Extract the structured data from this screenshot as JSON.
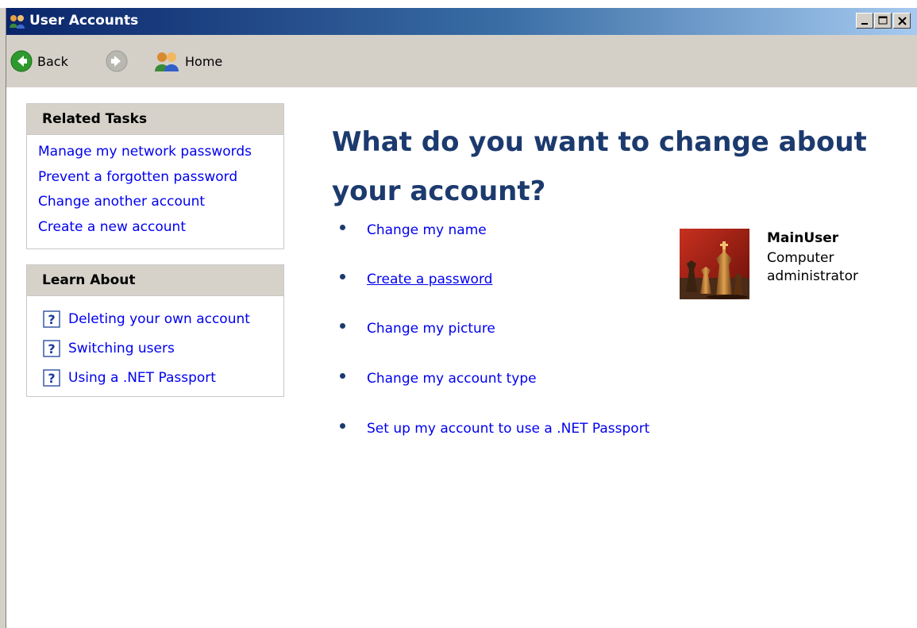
{
  "window": {
    "title": "User Accounts"
  },
  "toolbar": {
    "back_label": "Back",
    "home_label": "Home"
  },
  "related_tasks": {
    "header": "Related Tasks",
    "items": [
      {
        "label": "Manage my network passwords"
      },
      {
        "label": "Prevent a forgotten password"
      },
      {
        "label": "Change another account"
      },
      {
        "label": "Create a new account"
      }
    ]
  },
  "learn_about": {
    "header": "Learn About",
    "items": [
      {
        "label": "Deleting your own account",
        "icon": "help-icon"
      },
      {
        "label": "Switching users",
        "icon": "help-icon"
      },
      {
        "label": "Using a .NET Passport",
        "icon": "help-icon"
      }
    ]
  },
  "main": {
    "title": "What do you want to change about your account?",
    "options": [
      {
        "label": "Change my name"
      },
      {
        "label": "Create a password"
      },
      {
        "label": "Change my picture"
      },
      {
        "label": "Change my account type"
      },
      {
        "label": "Set up my account to use a .NET Passport"
      }
    ]
  },
  "user": {
    "name": "MainUser",
    "role": "Computer administrator",
    "picture": "chess-pieces-picture"
  },
  "colors": {
    "title_bar_start": "#0a246a",
    "title_bar_end": "#a6caf0",
    "chrome": "#d4d0c8",
    "link": "#0000ee",
    "heading": "#1c3a6e"
  }
}
